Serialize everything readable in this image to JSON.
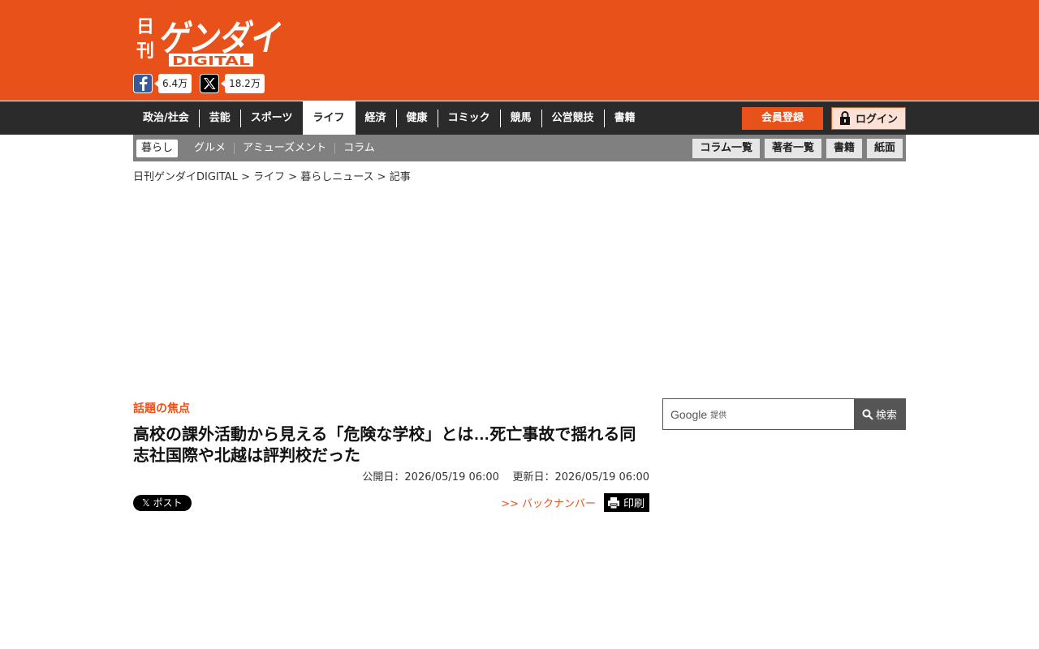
{
  "header": {
    "logo_top": "日刊",
    "logo_main": "ゲンダイ",
    "logo_sub": "DIGITAL",
    "facebook_count": "6.4万",
    "x_count": "18.2万"
  },
  "nav": {
    "items": [
      {
        "label": "政治/社会"
      },
      {
        "label": "芸能"
      },
      {
        "label": "スポーツ"
      },
      {
        "label": "ライフ"
      },
      {
        "label": "経済"
      },
      {
        "label": "健康"
      },
      {
        "label": "コミック"
      },
      {
        "label": "競馬"
      },
      {
        "label": "公営競技"
      },
      {
        "label": "書籍"
      }
    ],
    "active": "ライフ",
    "register_label": "会員登録",
    "login_label": "ログイン"
  },
  "subnav": {
    "items": [
      {
        "label": "暮らし"
      },
      {
        "label": "グルメ"
      },
      {
        "label": "アミューズメント"
      },
      {
        "label": "コラム"
      }
    ],
    "buttons": [
      {
        "label": "コラム一覧"
      },
      {
        "label": "著者一覧"
      },
      {
        "label": "書籍"
      },
      {
        "label": "紙面"
      }
    ]
  },
  "breadcrumb": {
    "home": "日刊ゲンダイDIGITAL",
    "sep": " > ",
    "level1": "ライフ",
    "level2": "暮らしニュース",
    "current": "記事"
  },
  "article": {
    "category": "話題の焦点",
    "title": "高校の課外活動から見える「危険な学校」とは…死亡事故で揺れる同志社国際や北越は評判校だった",
    "published": "公開日：2026/05/19 06:00",
    "updated": "更新日：2026/05/19 06:00",
    "x_post_label": "ポスト",
    "backnumber_label": ">> バックナンバー",
    "print_label": "印刷"
  },
  "search": {
    "provider": "Google",
    "provided": "提供",
    "button_label": "検索"
  },
  "colors": {
    "brand": "#e9511b",
    "nav_bg": "#2b2b2b",
    "subnav_bg": "#808080"
  }
}
